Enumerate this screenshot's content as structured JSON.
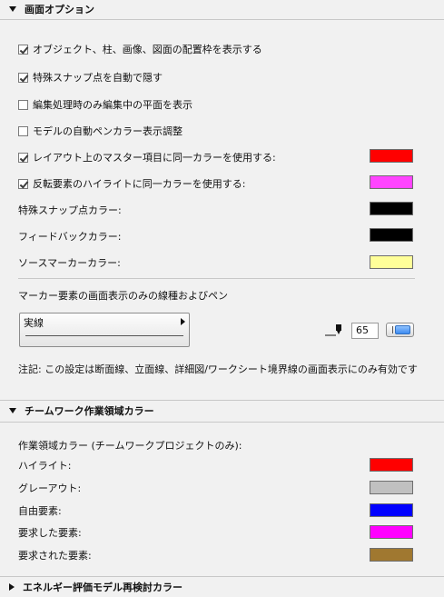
{
  "screen_options": {
    "title": "画面オプション",
    "checkboxes": [
      {
        "label": "オブジェクト、柱、画像、図面の配置枠を表示する",
        "checked": true
      },
      {
        "label": "特殊スナップ点を自動で隠す",
        "checked": true
      },
      {
        "label": "編集処理時のみ編集中の平面を表示",
        "checked": false
      },
      {
        "label": "モデルの自動ペンカラー表示調整",
        "checked": false
      },
      {
        "label": "レイアウト上のマスター項目に同一カラーを使用する:",
        "checked": true,
        "color": "#ff0000"
      },
      {
        "label": "反転要素のハイライトに同一カラーを使用する:",
        "checked": true,
        "color": "#ff44ff"
      }
    ],
    "color_rows": [
      {
        "label": "特殊スナップ点カラー:",
        "color": "#000000"
      },
      {
        "label": "フィードバックカラー:",
        "color": "#000000"
      },
      {
        "label": "ソースマーカーカラー:",
        "color": "#ffff99"
      }
    ],
    "marker_label": "マーカー要素の画面表示のみの線種およびペン",
    "line_type": "実線",
    "pen_number": "65",
    "note": "注記:  この設定は断面線、立面線、詳細図/ワークシート境界線の画面表示にのみ有効です"
  },
  "teamwork": {
    "title": "チームワーク作業領域カラー",
    "subtitle": "作業領域カラー (チームワークプロジェクトのみ):",
    "rows": [
      {
        "label": "ハイライト:",
        "color": "#ff0000"
      },
      {
        "label": "グレーアウト:",
        "color": "#c0c0c0"
      },
      {
        "label": "自由要素:",
        "color": "#0000ff"
      },
      {
        "label": "要求した要素:",
        "color": "#ff00ff"
      },
      {
        "label": "要求された要素:",
        "color": "#a07830"
      }
    ]
  },
  "energy": {
    "title": "エネルギー評価モデル再検討カラー"
  }
}
